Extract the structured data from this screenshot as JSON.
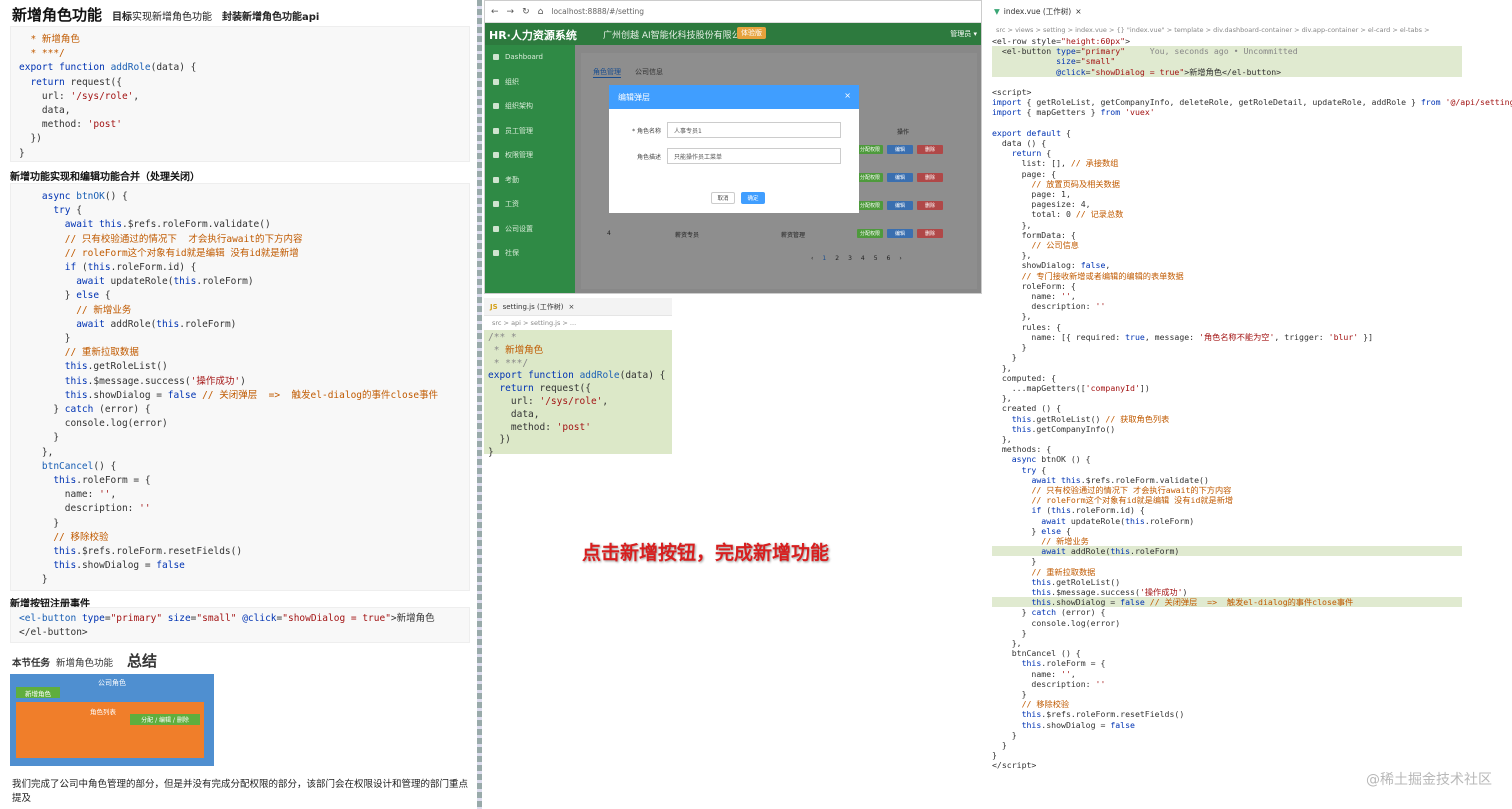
{
  "left": {
    "title": "新增角色功能",
    "goal_label": "目标",
    "goal_text": "实现新增角色功能",
    "api_heading": "封装新增角色功能api",
    "section_merge": "新增功能实现和编辑功能合并（处理关闭）",
    "section_register": "新增按钮注册事件",
    "task_label": "本节任务",
    "task_text": "新增角色功能",
    "summary_title": "总结",
    "diagram": {
      "outer": "公司角色",
      "add_btn": "新增角色",
      "inner": "角色列表",
      "ops": "分配 / 编辑 / 删除"
    },
    "summary_text": "我们完成了公司中角色管理的部分，但是并没有完成分配权限的部分，该部门会在权限设计和管理的部门重点提及"
  },
  "browser": {
    "url": "localhost:8888/#/setting",
    "logo": "HR·人力资源系统",
    "company": "广州创越 AI智能化科技股份有限公司",
    "tag": "体验版",
    "user": "管理员 ▾",
    "sidebar": [
      "Dashboard",
      "组织",
      "组织架构",
      "员工管理",
      "权限管理",
      "考勤",
      "工资",
      "公司设置",
      "社保"
    ],
    "tabs": [
      "角色管理",
      "公司信息"
    ],
    "ops_header": "操作",
    "op_assign": "分配权限",
    "op_edit": "编辑",
    "op_delete": "删除",
    "row_index": "4",
    "row_name": "薪资专员",
    "row_desc": "薪资管理",
    "pages": [
      "‹",
      "1",
      "2",
      "3",
      "4",
      "5",
      "6",
      "›"
    ],
    "dialog": {
      "title": "编辑弹层",
      "label_name": "* 角色名称",
      "value_name": "人事专员1",
      "label_desc": "角色描述",
      "value_desc": "只能操作员工菜单",
      "cancel": "取消",
      "confirm": "确定"
    }
  },
  "editor_small": {
    "tab": "setting.js (工作树)",
    "crumb": "src > api > setting.js > ..."
  },
  "overlay_title": "点击新增按钮，完成新增功能",
  "right": {
    "tab": "index.vue (工作树)",
    "crumb": "src > views > setting > index.vue > {} \"index.vue\" > template > div.dashboard-container > div.app-container > el-card > el-tabs >",
    "watermark": "@稀土掘金技术社区"
  },
  "colors": {
    "accent_green": "#2d7a3e",
    "dialog_blue": "#409eff",
    "overlay_red": "#d81e1e",
    "diagram_blue": "#4f8fd0",
    "diagram_orange": "#f07e2a"
  }
}
